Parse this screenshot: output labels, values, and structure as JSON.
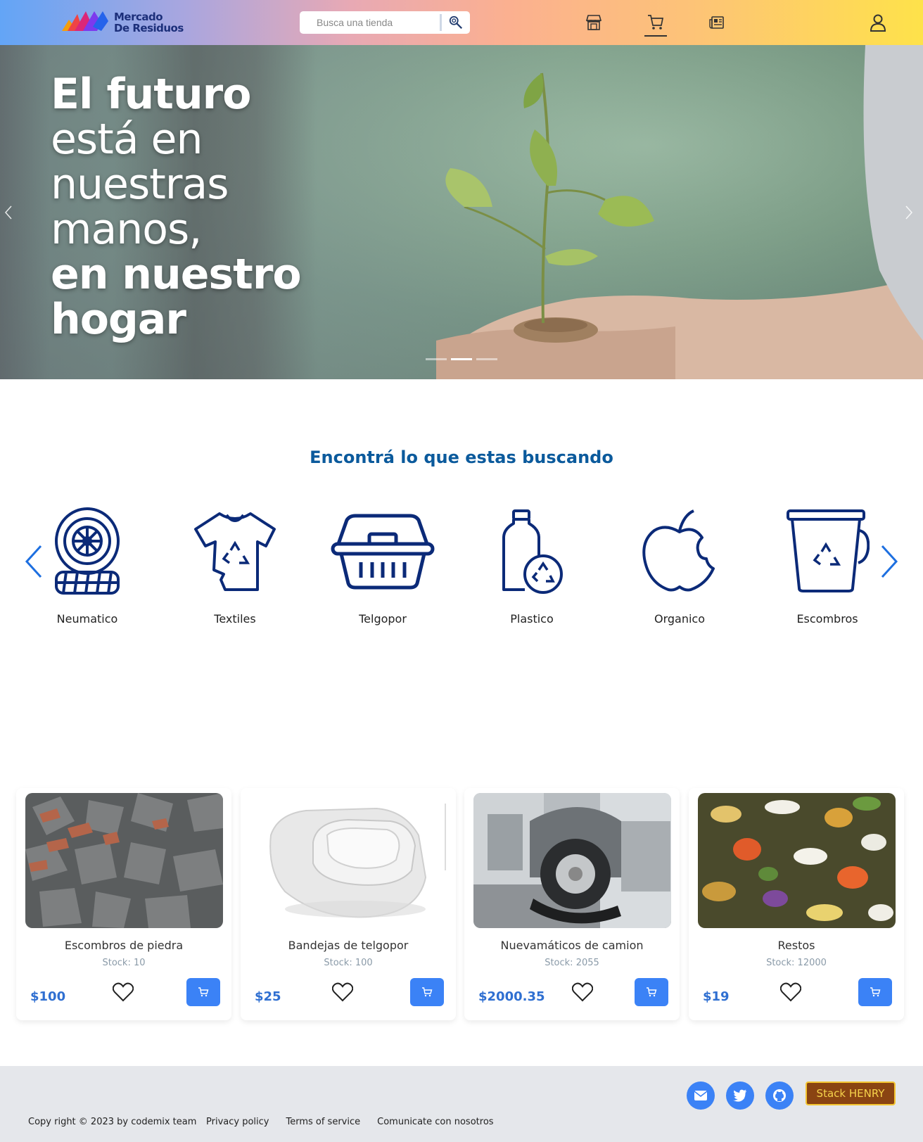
{
  "header": {
    "logo_line1": "Mercado",
    "logo_line2": "De Residuos",
    "search_placeholder": "Busca una tienda",
    "nav_icons": [
      "store-icon",
      "cart-icon",
      "news-icon"
    ],
    "user_icon": "user-icon"
  },
  "hero": {
    "line1": "El futuro",
    "line2": "está en",
    "line3": "nuestras",
    "line4": "manos,",
    "line5": "en nuestro",
    "line6": "hogar",
    "slides": 3,
    "active_slide": 2
  },
  "categories": {
    "title": "Encontrá lo que estas buscando",
    "items": [
      {
        "label": "Neumatico",
        "icon": "tire-icon"
      },
      {
        "label": "Textiles",
        "icon": "tshirt-icon"
      },
      {
        "label": "Telgopor",
        "icon": "foam-container-icon"
      },
      {
        "label": "Plastico",
        "icon": "bottle-icon"
      },
      {
        "label": "Organico",
        "icon": "apple-icon"
      },
      {
        "label": "Escombros",
        "icon": "bucket-icon"
      }
    ],
    "color": "#0b2a78"
  },
  "products": [
    {
      "name": "Escombros de piedra",
      "stock": "Stock: 10",
      "price": "$100"
    },
    {
      "name": "Bandejas de telgopor",
      "stock": "Stock: 100",
      "price": "$25"
    },
    {
      "name": "Nuevamáticos de camion",
      "stock": "Stock: 2055",
      "price": "$2000.35"
    },
    {
      "name": "Restos",
      "stock": "Stock: 12000",
      "price": "$19"
    }
  ],
  "footer": {
    "copyright": "Copy right © 2023 by codemix team",
    "links": [
      "Privacy policy",
      "Terms of service",
      "Comunicate con nosotros"
    ],
    "social_icons": [
      "mail-icon",
      "twitter-icon",
      "github-icon"
    ],
    "stack_button": "Stack HENRY"
  },
  "colors": {
    "accent": "#3b82f6",
    "title_blue": "#0b5a9c",
    "price_blue": "#2f6fd1"
  }
}
